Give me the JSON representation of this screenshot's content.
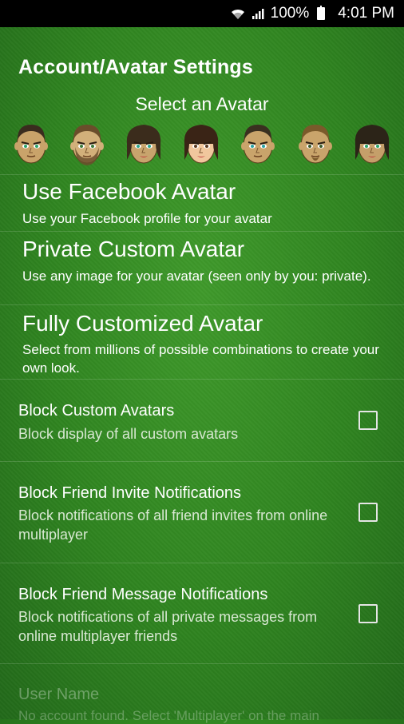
{
  "status_bar": {
    "battery": "100%",
    "time": "4:01 PM",
    "icons": [
      "wifi-icon",
      "signal-icon",
      "battery-icon"
    ]
  },
  "title": "Account/Avatar Settings",
  "avatar_section": {
    "label": "Select an Avatar",
    "avatars": [
      {
        "name": "avatar-1",
        "skin": "#c9a36a",
        "hair": "#3a2c1e",
        "eyes": "#2aa36b",
        "style": "male"
      },
      {
        "name": "avatar-2",
        "skin": "#d2b07a",
        "hair": "#6a4d2b",
        "eyes": "#3a7a3a",
        "style": "male-beard"
      },
      {
        "name": "avatar-3",
        "skin": "#c8a46d",
        "hair": "#3b2c1c",
        "eyes": "#2aa38a",
        "style": "female"
      },
      {
        "name": "avatar-4",
        "skin": "#f1c79d",
        "hair": "#3a2416",
        "eyes": "#5b3a22",
        "style": "female-selected"
      },
      {
        "name": "avatar-5",
        "skin": "#c9a46b",
        "hair": "#3a3020",
        "eyes": "#2aa3a3",
        "style": "male"
      },
      {
        "name": "avatar-6",
        "skin": "#c9a46b",
        "hair": "#7a5a2b",
        "eyes": "#3a5a2b",
        "style": "male-goatee"
      },
      {
        "name": "avatar-7",
        "skin": "#c59f6a",
        "hair": "#2c2418",
        "eyes": "#2aa36b",
        "style": "female"
      }
    ]
  },
  "options": [
    {
      "title": "Use Facebook Avatar",
      "desc": "Use your Facebook profile for your avatar"
    },
    {
      "title": "Private Custom Avatar",
      "desc": "Use any image for your avatar (seen only by you: private)."
    },
    {
      "title": "Fully Customized Avatar",
      "desc": "Select from millions of possible combinations to create your own look."
    }
  ],
  "preferences": [
    {
      "title": "Block Custom Avatars",
      "desc": "Block display of all custom avatars",
      "checked": false
    },
    {
      "title": "Block Friend Invite Notifications",
      "desc": "Block notifications of all friend invites from online multiplayer",
      "checked": false
    },
    {
      "title": "Block Friend Message Notifications",
      "desc": "Block notifications of all private messages from online multiplayer friends",
      "checked": false
    }
  ],
  "user_name": {
    "title": "User Name",
    "desc": "No account found. Select 'Multiplayer' on the main"
  }
}
